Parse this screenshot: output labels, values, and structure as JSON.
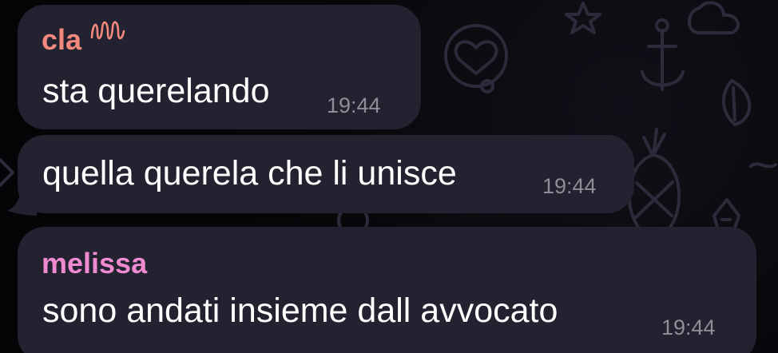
{
  "chat": {
    "messages": [
      {
        "sender": "cla",
        "sender_color": "#f2897c",
        "sender_icon": "wavy-emoji-icon",
        "text": "sta querelando",
        "time": "19:44"
      },
      {
        "sender": "",
        "text": "quella querela che li unisce",
        "time": "19:44"
      },
      {
        "sender": "melissa",
        "sender_color": "#f08ad0",
        "text": "sono andati insieme dall avvocato",
        "time": "19:44"
      }
    ],
    "colors": {
      "background": "#050507",
      "bubble": "#222230",
      "message_text": "#ffffff",
      "timestamp": "#8e8e98"
    }
  }
}
